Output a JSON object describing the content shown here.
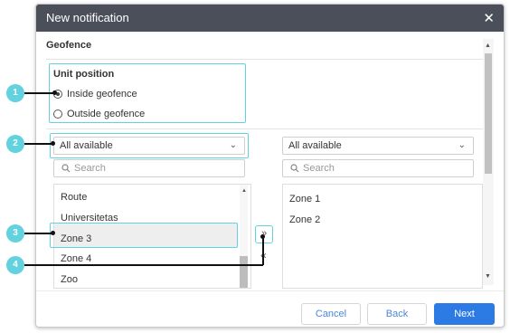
{
  "dialog": {
    "title": "New notification",
    "close_label": "✕"
  },
  "section": {
    "title": "Geofence"
  },
  "unit_position": {
    "label": "Unit position",
    "options": [
      {
        "label": "Inside geofence",
        "checked": true
      },
      {
        "label": "Outside geofence",
        "checked": false
      }
    ]
  },
  "left_panel": {
    "filter_value": "All available",
    "search_placeholder": "Search",
    "items": [
      "Route",
      "Universitetas",
      "Zone 3",
      "Zone 4",
      "Zoo"
    ],
    "selected_item": "Zone 3"
  },
  "right_panel": {
    "filter_value": "All available",
    "search_placeholder": "Search",
    "items": [
      "Zone 1",
      "Zone 2"
    ]
  },
  "transfer": {
    "move_right_label": "»",
    "move_left_label": "«"
  },
  "footer": {
    "cancel_label": "Cancel",
    "back_label": "Back",
    "next_label": "Next"
  },
  "callouts": [
    "1",
    "2",
    "3",
    "4"
  ],
  "colors": {
    "titlebar": "#4a4f59",
    "highlight": "#61d3e0",
    "primary": "#2c7be5",
    "badge": "#62d2df"
  }
}
